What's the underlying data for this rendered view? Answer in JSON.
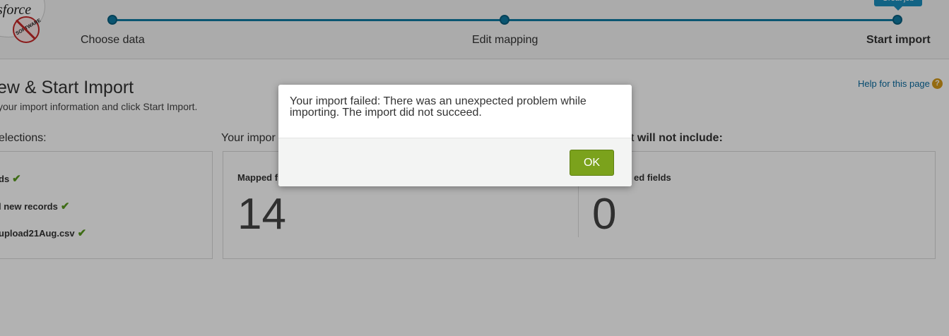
{
  "logo": {
    "text": "sforce",
    "badge_text": "SOFTWARE"
  },
  "progress": {
    "steps": [
      {
        "label": "Choose data"
      },
      {
        "label": "Edit mapping"
      },
      {
        "label": "Start import"
      }
    ],
    "tooltip": "Great job"
  },
  "page": {
    "title": "ew & Start Import",
    "subtitle": "your import information and click Start Import.",
    "help_link": "Help for this page",
    "help_icon": "?"
  },
  "selections": {
    "heading": "elections:",
    "items": [
      {
        "label": "ds"
      },
      {
        "label": "l new records"
      },
      {
        "label": "upload21Aug.csv"
      }
    ],
    "check_icon": "check-icon"
  },
  "includes": {
    "heading": "Your impor",
    "stat_label": "Mapped f",
    "stat_value": "14"
  },
  "excludes": {
    "heading_prefix": "t ",
    "heading_bold": "will not include:",
    "stat_label": "ed fields",
    "stat_value": "0"
  },
  "modal": {
    "message": "Your import failed: There was an unexpected problem while importing. The import did not succeed.",
    "ok_label": "OK"
  },
  "colors": {
    "accent": "#0f7aa3",
    "ok_button": "#7ba21c",
    "check": "#5a9b1f",
    "help_icon": "#d49a1a"
  }
}
